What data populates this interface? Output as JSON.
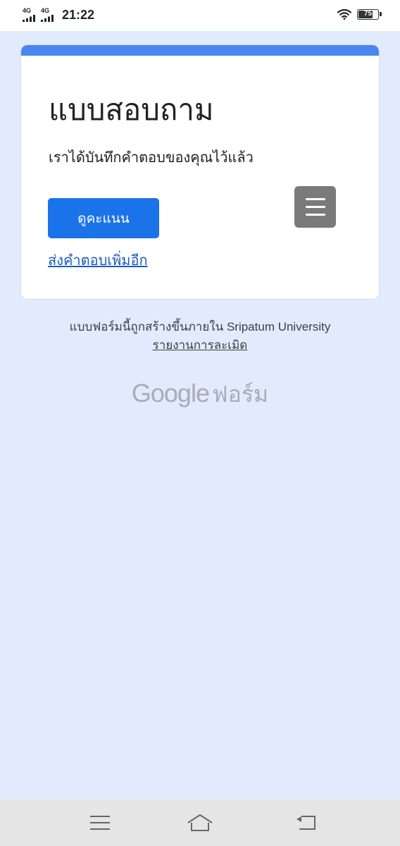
{
  "status_bar": {
    "network_1": "4G",
    "network_2": "4G",
    "time": "21:22",
    "battery_level": "75",
    "battery_fraction": 0.75
  },
  "form": {
    "title": "แบบสอบถาม",
    "message": "เราได้บันทึกคำตอบของคุณไว้แล้ว",
    "view_score_label": "ดูคะแนน",
    "submit_another_label": "ส่งคำตอบเพิ่มอีก"
  },
  "footer": {
    "note": "แบบฟอร์มนี้ถูกสร้างขึ้นภายใน Sripatum University",
    "report_label": "รายงานการละเมิด",
    "logo_google": "Google",
    "logo_forms": "ฟอร์ม"
  },
  "colors": {
    "accent": "#4a86f0",
    "button": "#1a73e8",
    "background": "#e1ebfd"
  },
  "icons": {
    "menu": "menu-icon",
    "home": "home-icon",
    "back": "back-icon",
    "wifi": "wifi-icon",
    "signal": "signal-icon",
    "battery": "battery-icon"
  }
}
